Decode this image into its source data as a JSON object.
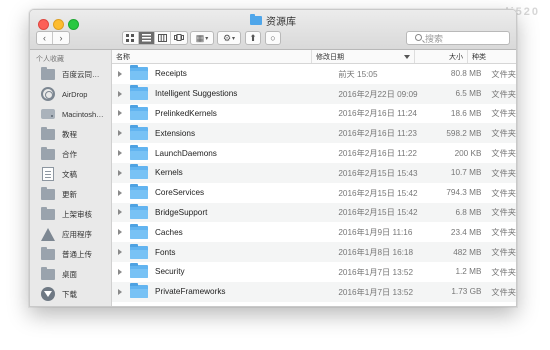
{
  "window": {
    "title": "资源库"
  },
  "toolbar": {
    "back_glyph": "‹",
    "forward_glyph": "›",
    "view_icons": [
      "icon-view-icon",
      "list-view-icon",
      "column-view-icon",
      "coverflow-view-icon"
    ],
    "arrange_glyph": "▦",
    "action_glyph": "⚙",
    "share_glyph": "⬆",
    "tag_glyph": "○",
    "search_placeholder": "搜索"
  },
  "watermark": "www.li520",
  "sidebar": {
    "section_title": "个人收藏",
    "items": [
      {
        "label": "百度云同…",
        "icon": "folder-icon"
      },
      {
        "label": "AirDrop",
        "icon": "airdrop-icon"
      },
      {
        "label": "Macintosh…",
        "icon": "disk-icon"
      },
      {
        "label": "教程",
        "icon": "folder-icon"
      },
      {
        "label": "合作",
        "icon": "folder-icon"
      },
      {
        "label": "文稿",
        "icon": "documents-icon"
      },
      {
        "label": "更新",
        "icon": "folder-icon"
      },
      {
        "label": "上架审核",
        "icon": "folder-icon"
      },
      {
        "label": "应用程序",
        "icon": "applications-icon"
      },
      {
        "label": "普通上传",
        "icon": "folder-icon"
      },
      {
        "label": "桌面",
        "icon": "folder-icon"
      },
      {
        "label": "下载",
        "icon": "downloads-icon"
      }
    ]
  },
  "columns": {
    "name": "名称",
    "date": "修改日期",
    "size": "大小",
    "kind": "种类"
  },
  "files": [
    {
      "name": "Receipts",
      "date": "前天 15:05",
      "size": "80.8 MB",
      "kind": "文件夹"
    },
    {
      "name": "Intelligent Suggestions",
      "date": "2016年2月22日 09:09",
      "size": "6.5 MB",
      "kind": "文件夹"
    },
    {
      "name": "PrelinkedKernels",
      "date": "2016年2月16日 11:24",
      "size": "18.6 MB",
      "kind": "文件夹"
    },
    {
      "name": "Extensions",
      "date": "2016年2月16日 11:23",
      "size": "598.2 MB",
      "kind": "文件夹"
    },
    {
      "name": "LaunchDaemons",
      "date": "2016年2月16日 11:22",
      "size": "200 KB",
      "kind": "文件夹"
    },
    {
      "name": "Kernels",
      "date": "2016年2月15日 15:43",
      "size": "10.7 MB",
      "kind": "文件夹"
    },
    {
      "name": "CoreServices",
      "date": "2016年2月15日 15:42",
      "size": "794.3 MB",
      "kind": "文件夹"
    },
    {
      "name": "BridgeSupport",
      "date": "2016年2月15日 15:42",
      "size": "6.8 MB",
      "kind": "文件夹"
    },
    {
      "name": "Caches",
      "date": "2016年1月9日 11:16",
      "size": "23.4 MB",
      "kind": "文件夹"
    },
    {
      "name": "Fonts",
      "date": "2016年1月8日 16:18",
      "size": "482 MB",
      "kind": "文件夹"
    },
    {
      "name": "Security",
      "date": "2016年1月7日 13:52",
      "size": "1.2 MB",
      "kind": "文件夹"
    },
    {
      "name": "PrivateFrameworks",
      "date": "2016年1月7日 13:52",
      "size": "1.73 GB",
      "kind": "文件夹"
    }
  ]
}
